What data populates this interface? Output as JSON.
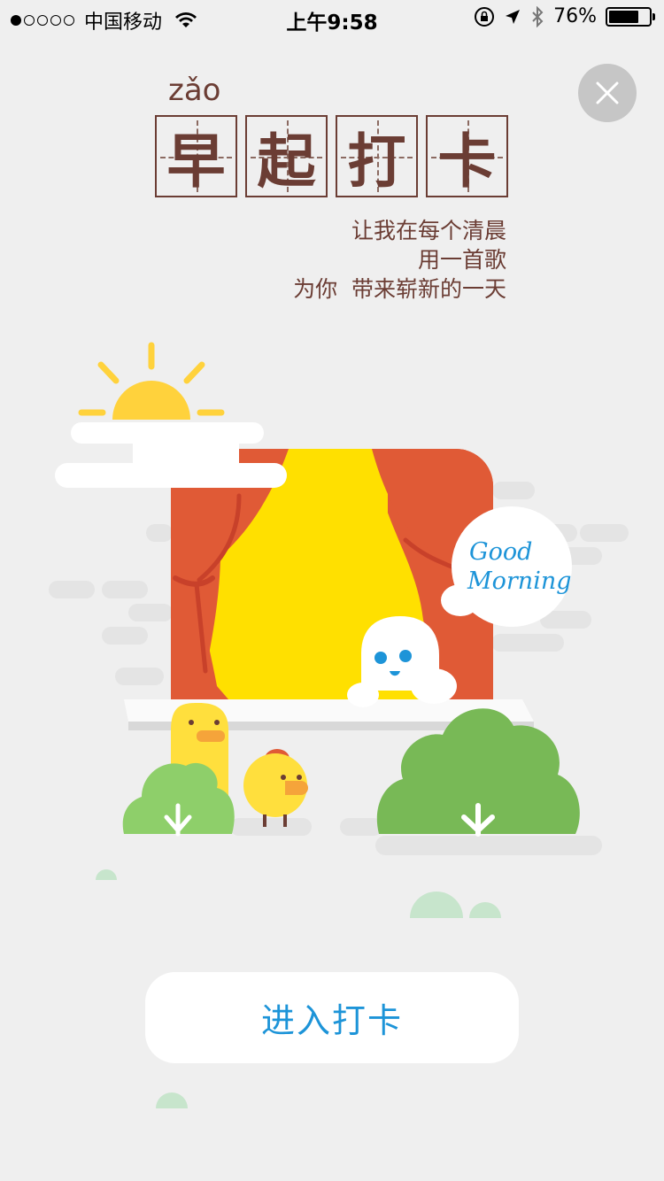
{
  "status_bar": {
    "carrier": "中国移动",
    "time": "上午9:58",
    "battery": "76%",
    "battery_level": 0.76
  },
  "header": {
    "pinyin": "zǎo",
    "title_chars": [
      "早",
      "起",
      "打",
      "卡"
    ],
    "slogan": "让我在每个清晨\n用一首歌\n为你  带来崭新的一天"
  },
  "illustration": {
    "speech_text_1": "Good",
    "speech_text_2": "Morning"
  },
  "actions": {
    "enter_label": "进入打卡"
  },
  "colors": {
    "accent": "#1d94d8",
    "title": "#6b3d34",
    "curtain": "#e05a36",
    "window": "#ffe000",
    "sun": "#ffd23c",
    "bush_light": "#8ecf6a",
    "bush_dark": "#78b956"
  },
  "icons": [
    "wifi-icon",
    "lock-rotation-icon",
    "location-arrow-icon",
    "bluetooth-icon",
    "battery-icon",
    "close-icon",
    "sun-icon"
  ]
}
